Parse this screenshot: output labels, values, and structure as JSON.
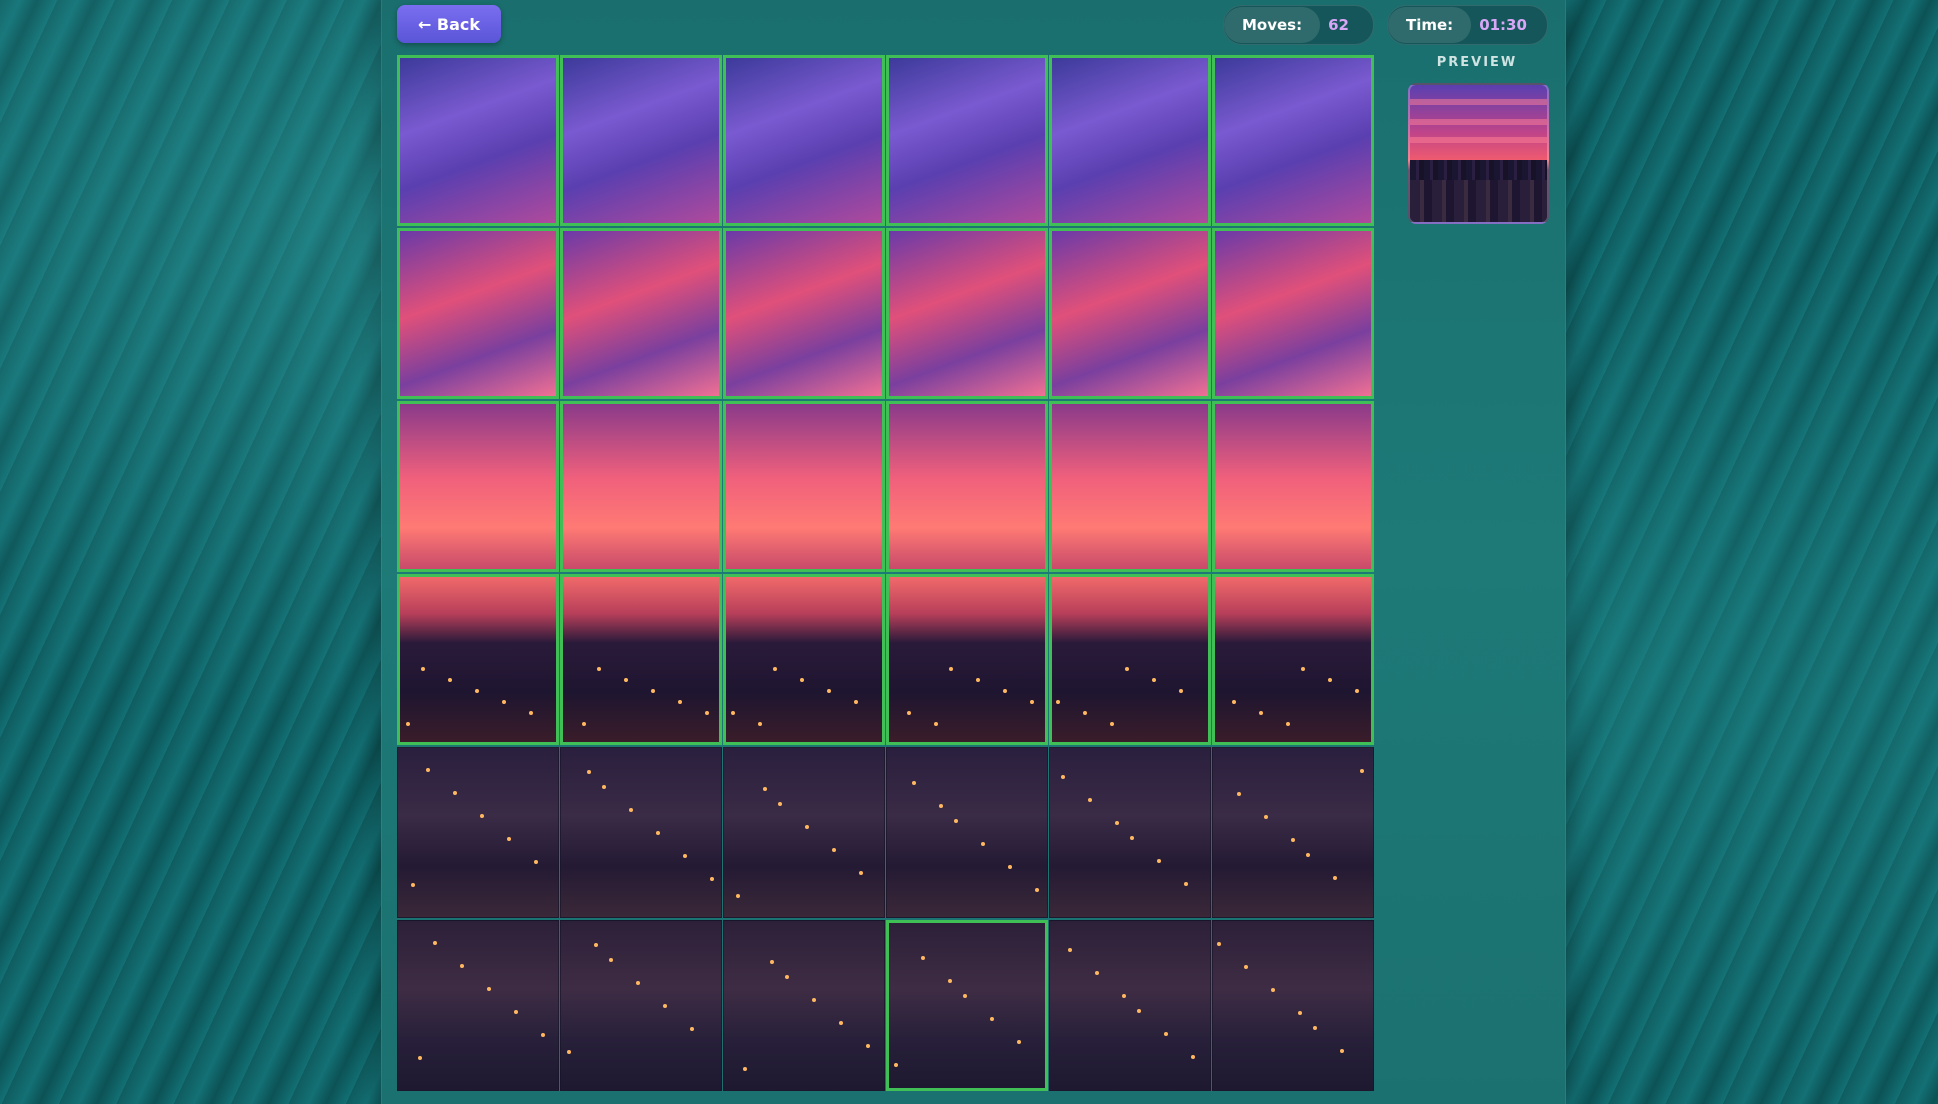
{
  "header": {
    "back_label": "← Back",
    "moves_label": "Moves:",
    "moves_value": "62",
    "time_label": "Time:",
    "time_value": "01:30"
  },
  "preview": {
    "label": "PREVIEW"
  },
  "puzzle": {
    "rows": 6,
    "cols": 6,
    "solved_rows": [
      0,
      1,
      2,
      3
    ],
    "extra_correct_tiles": [
      [
        5,
        3
      ]
    ]
  },
  "colors": {
    "back_button": "#6b62e4",
    "correct_border": "#3fbf55",
    "stat_value": "#d8a6f6",
    "panel": "#1b7170"
  },
  "icons": {
    "back": "left-arrow-icon"
  }
}
